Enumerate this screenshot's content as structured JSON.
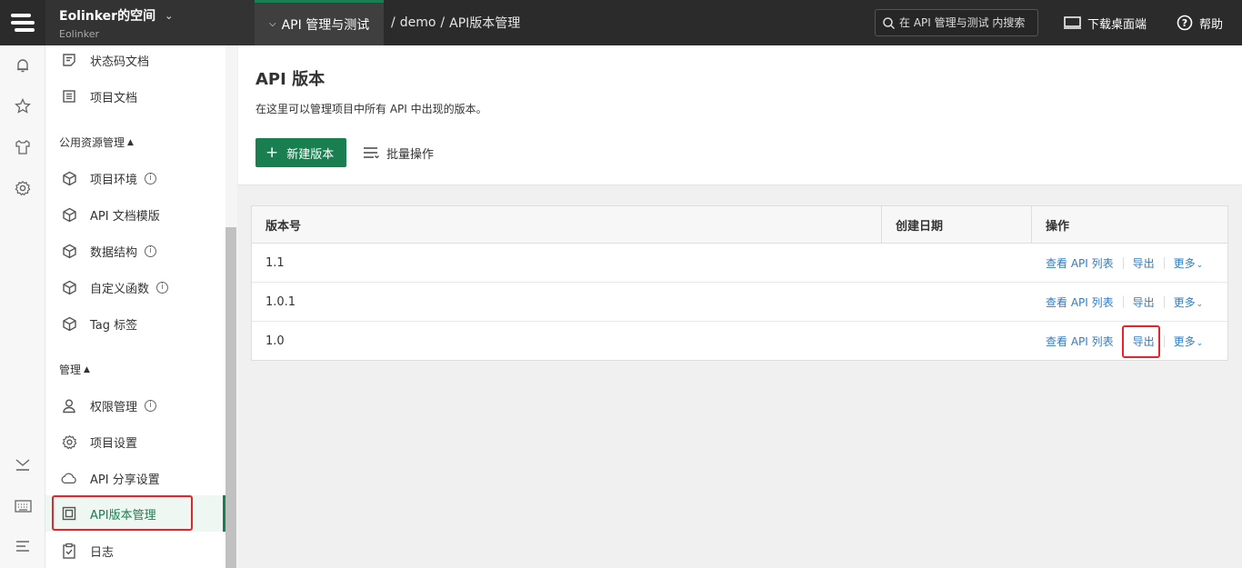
{
  "workspace": {
    "name": "Eolinker的空间",
    "sub": "Eolinker"
  },
  "project_tab": "API 管理与测试",
  "breadcrumb": [
    "/",
    "demo",
    "/",
    "API版本管理"
  ],
  "search": {
    "placeholder": "在 API 管理与测试 内搜索"
  },
  "top_actions": {
    "download": "下载桌面端",
    "help": "帮助"
  },
  "rail_icons": [
    "bell-icon",
    "star-icon",
    "shirt-icon",
    "gear-icon",
    "collapse-icon",
    "keyboard-icon",
    "menu-icon"
  ],
  "sidebar": {
    "items_top": [
      {
        "label": "状态码文档",
        "icon": "doc-icon"
      },
      {
        "label": "项目文档",
        "icon": "list-doc-icon"
      }
    ],
    "group_public": "公用资源管理",
    "public_items": [
      {
        "label": "项目环境",
        "info": "i"
      },
      {
        "label": "API 文档模版",
        "info": ""
      },
      {
        "label": "数据结构",
        "info": "i"
      },
      {
        "label": "自定义函数",
        "info": "i"
      },
      {
        "label": "Tag 标签",
        "info": ""
      }
    ],
    "group_manage": "管理",
    "manage_items": [
      {
        "label": "权限管理",
        "icon": "user-icon",
        "info": "i"
      },
      {
        "label": "项目设置",
        "icon": "gear-icon",
        "info": ""
      },
      {
        "label": "API 分享设置",
        "icon": "cloud-icon",
        "info": ""
      },
      {
        "label": "API版本管理",
        "icon": "copy-icon",
        "info": "",
        "active": true
      },
      {
        "label": "日志",
        "icon": "clipboard-icon",
        "info": ""
      }
    ]
  },
  "main": {
    "title": "API 版本",
    "description": "在这里可以管理项目中所有 API 中出现的版本。",
    "new_button": "新建版本",
    "batch_button": "批量操作"
  },
  "table": {
    "columns": [
      "版本号",
      "创建日期",
      "操作"
    ],
    "rows": [
      {
        "version": "1.1",
        "date": ""
      },
      {
        "version": "1.0.1",
        "date": ""
      },
      {
        "version": "1.0",
        "date": ""
      }
    ],
    "actions": {
      "view": "查看 API 列表",
      "export": "导出",
      "more": "更多"
    }
  },
  "colors": {
    "accent": "#1a7f50",
    "link": "#2f7ec6",
    "highlight": "#e6252a",
    "topbar": "#2b2b2b"
  }
}
